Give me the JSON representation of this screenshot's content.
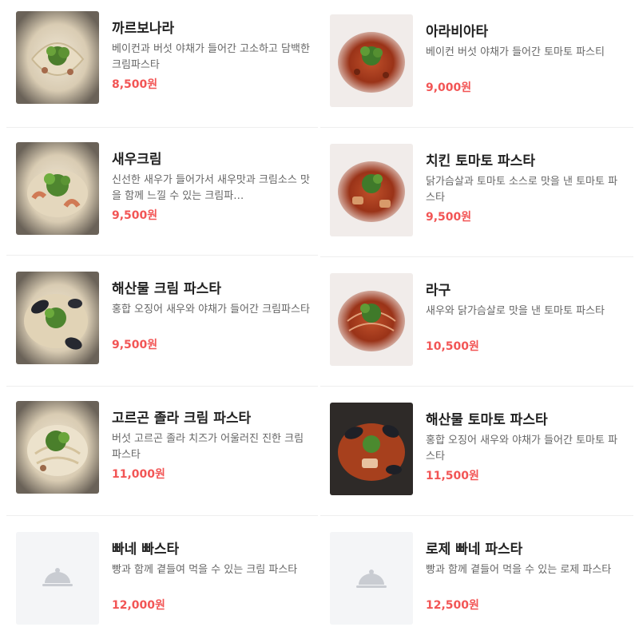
{
  "menu": {
    "left": [
      {
        "name": "까르보나라",
        "desc": "베이컨과 버섯 야채가 들어간 고소하고 담백한 크림파스타",
        "price": "8,500원",
        "image": "cream-pasta-photo"
      },
      {
        "name": "새우크림",
        "desc": "신선한 새우가 들어가서 새우맛과 크림소스 맛을 함께 느낄 수 있는 크림파…",
        "price": "9,500원",
        "image": "shrimp-cream-pasta-photo"
      },
      {
        "name": "해산물 크림 파스타",
        "desc": "홍합 오징어 새우와 야채가 들어간 크림파스타",
        "price": "9,500원",
        "image": "seafood-cream-pasta-photo"
      },
      {
        "name": "고르곤 졸라 크림 파스타",
        "desc": "버섯 고르곤 졸라 치즈가 어울러진 진한 크림 파스타",
        "price": "11,000원",
        "image": "gorgonzola-cream-pasta-photo"
      },
      {
        "name": "빠네 빠스타",
        "desc": "빵과 함께 곁들여 먹을 수 있는 크림 파스타",
        "price": "12,000원",
        "image": "cloche-placeholder-icon"
      }
    ],
    "right": [
      {
        "name": "아라비아타",
        "desc": "베이컨 버섯 야채가 들어간 토마토 파스티",
        "price": "9,000원",
        "image": "tomato-pasta-photo"
      },
      {
        "name": "치킨 토마토 파스타",
        "desc": "닭가슴살과 토마토 소스로 맛을 낸 토마토 파스타",
        "price": "9,500원",
        "image": "chicken-tomato-pasta-photo"
      },
      {
        "name": "라구",
        "desc": "새우와 닭가슴살로 맛을 낸 토마토 파스타",
        "price": "10,500원",
        "image": "ragu-pasta-photo"
      },
      {
        "name": "해산물 토마토 파스타",
        "desc": "홍합 오징어 새우와 야채가 들어간 토마토 파스타",
        "price": "11,500원",
        "image": "seafood-tomato-pasta-photo"
      },
      {
        "name": "로제 빠네 파스타",
        "desc": "빵과 함께 곁들어 먹을 수 있는 로제 파스타",
        "price": "12,500원",
        "image": "cloche-placeholder-icon"
      }
    ]
  },
  "colors": {
    "price": "#f25555",
    "divider": "#eeeeee",
    "placeholder_bg": "#f4f5f7"
  }
}
